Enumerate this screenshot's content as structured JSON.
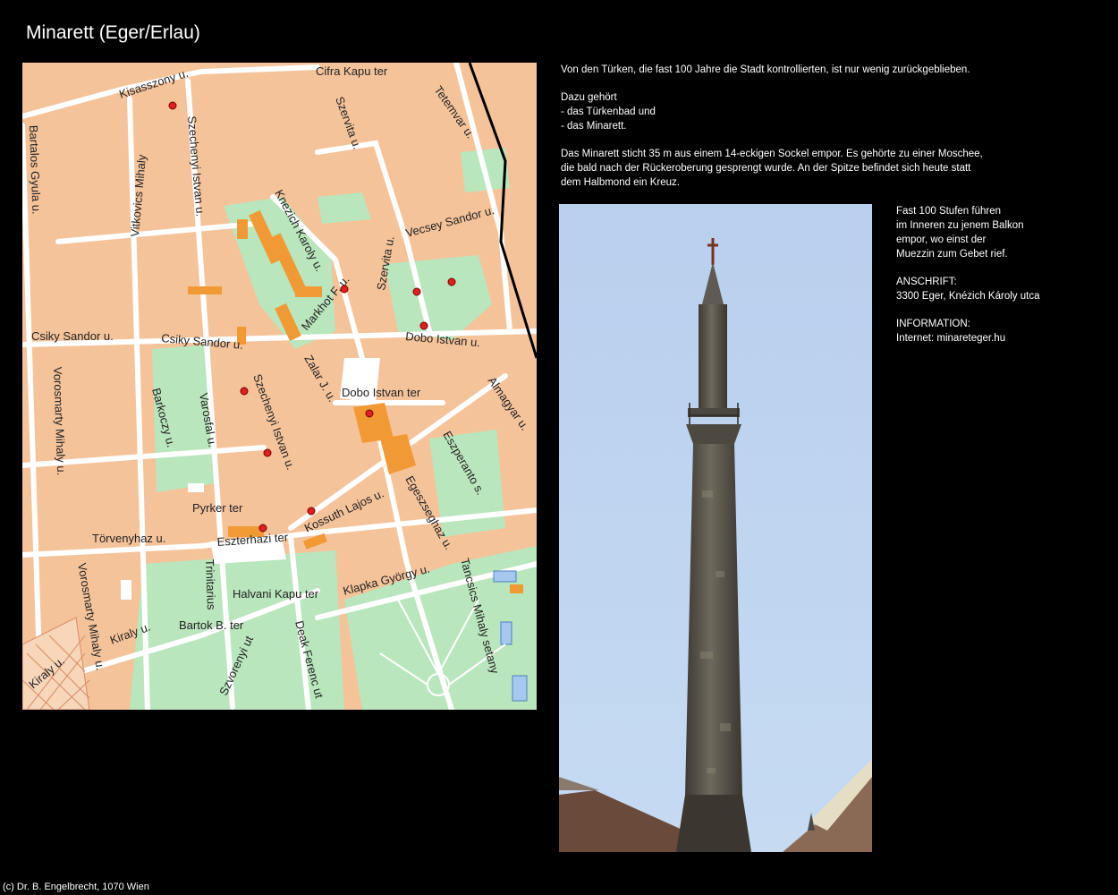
{
  "page": {
    "title": "Minarett (Eger/Erlau)",
    "footer": "(c) Dr. B. Engelbrecht, 1070 Wien"
  },
  "intro": {
    "p1": "Von den Türken, die fast 100 Jahre die Stadt kontrollierten, ist nur wenig zurückgeblieben.",
    "p2_lines": [
      "Dazu gehört",
      "- das Türkenbad und",
      "- das Minarett."
    ],
    "p3_lines": [
      "Das Minarett sticht 35 m aus einem 14-eckigen  Sockel empor. Es gehörte zu einer Moschee,",
      "die bald nach der Rückeroberung gesprengt wurde. An der Spitze befindet sich heute statt",
      "dem Halbmond ein Kreuz."
    ]
  },
  "side": {
    "p1_lines": [
      "Fast 100 Stufen führen",
      "im Inneren zu jenem Balkon",
      "empor, wo einst der",
      "Muezzin zum Gebet rief."
    ],
    "address_label": "ANSCHRIFT:",
    "address": "3300 Eger, Knézich Károly utca",
    "info_label": "INFORMATION:",
    "info": "Internet: minareteger.hu"
  },
  "map": {
    "streets": [
      "Cifra Kapu ter",
      "Kisasszony u.",
      "Tetemvar u.",
      "Szervita u.",
      "Bartalos Gyula u.",
      "Szechenyi Istvan u.",
      "Vitkovics Mihaly",
      "Knezich Karoly u.",
      "Vecsey Sandor u.",
      "Szervita u.",
      "Markhot F. u.",
      "Dobo Istvan u.",
      "Csiky Sandor u.",
      "Csiky Sandor u.",
      "Zalar J. u.",
      "Dobo Istvan ter",
      "Almagyar u.",
      "Barkoczy u.",
      "Varosfal u.",
      "Szechenyi Istvan u.",
      "Vorosmarty Mihaly u.",
      "Eszperanto s.",
      "Pyrker ter",
      "Kossuth Lajos u.",
      "Egeszseghaz u.",
      "Törvenyhaz u.",
      "Eszterhazi ter",
      "Klapka György u.",
      "Tancsics Mihaly setany",
      "Trinitarius",
      "Halvani Kapu ter",
      "Bartok B. ter",
      "Kiraly u.",
      "Szvorenyi ut",
      "Deak Ferenc ut",
      "Kiraly u.",
      "Vorosmarty Mihaly u."
    ]
  },
  "colors": {
    "background": "#000000",
    "map_land": "#f5c39a",
    "map_green": "#b9e6bd",
    "map_orange": "#f19a35",
    "sky": "#bcd3ef"
  }
}
